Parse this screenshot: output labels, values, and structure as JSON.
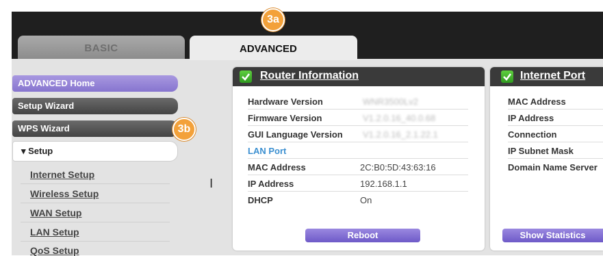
{
  "tabs": {
    "basic": "BASIC",
    "advanced": "ADVANCED"
  },
  "callouts": {
    "tab": "3a",
    "wps": "3b"
  },
  "sidebar": {
    "home": "ADVANCED Home",
    "setup_wizard": "Setup Wizard",
    "wps_wizard": "WPS Wizard",
    "setup_section": "▾ Setup",
    "links": [
      "Internet Setup",
      "Wireless Setup",
      "WAN Setup",
      "LAN Setup",
      "QoS Setup"
    ]
  },
  "router_panel": {
    "title": "Router Information",
    "rows": [
      {
        "label": "Hardware Version",
        "value": "WNR3500Lv2"
      },
      {
        "label": "Firmware Version",
        "value": "V1.2.0.16_40.0.68"
      },
      {
        "label": "GUI Language Version",
        "value": "V1.2.0.16_2.1.22.1"
      },
      {
        "label": "LAN Port",
        "value": ""
      },
      {
        "label": "MAC Address",
        "value": "2C:B0:5D:43:63:16"
      },
      {
        "label": "IP Address",
        "value": "192.168.1.1"
      },
      {
        "label": "DHCP",
        "value": "On"
      }
    ],
    "button": "Reboot"
  },
  "internet_panel": {
    "title": "Internet Port",
    "rows": [
      "MAC Address",
      "IP Address",
      "Connection",
      "IP Subnet Mask",
      "Domain Name Server"
    ],
    "button": "Show Statistics"
  },
  "cursor_icon": "text-cursor-icon"
}
